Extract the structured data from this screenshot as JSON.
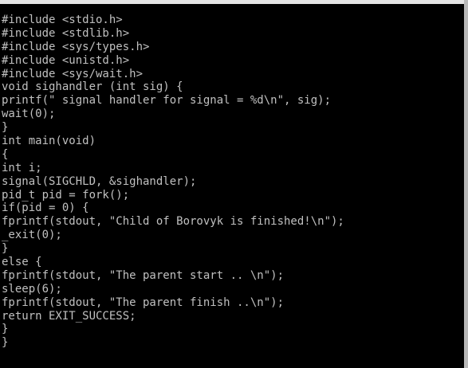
{
  "terminal": {
    "lines": [
      "#include <stdio.h>",
      "#include <stdlib.h>",
      "#include <sys/types.h>",
      "#include <unistd.h>",
      "#include <sys/wait.h>",
      "void sighandler (int sig) {",
      "printf(\" signal handler for signal = %d\\n\", sig);",
      "wait(0);",
      "}",
      "int main(void)",
      "{",
      "int i;",
      "signal(SIGCHLD, &sighandler);",
      "pid_t pid = fork();",
      "if(pid = 0) {",
      "fprintf(stdout, \"Child of Borovyk is finished!\\n\");",
      "_exit(0);",
      "}",
      "else {",
      "fprintf(stdout, \"The parent start .. \\n\");",
      "sleep(6);",
      "fprintf(stdout, \"The parent finish ..\\n\");",
      "return EXIT_SUCCESS;",
      "}",
      "}"
    ]
  },
  "colors": {
    "background": "#000000",
    "text": "#c0c0c0"
  }
}
